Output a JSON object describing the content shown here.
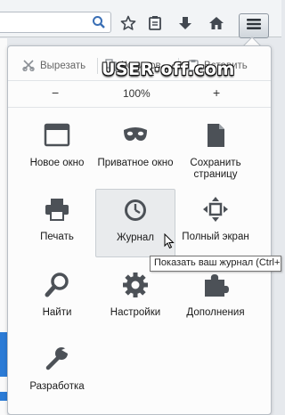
{
  "toolbar": {
    "icons": [
      "search-icon",
      "star-icon",
      "reading-list-icon",
      "download-icon",
      "home-icon",
      "menu-icon"
    ]
  },
  "edit": {
    "cut_label": "Вырезать",
    "copy_label": "Копиров...",
    "paste_label": "Вставить"
  },
  "zoom": {
    "minus": "−",
    "level": "100%",
    "plus": "+"
  },
  "watermark": {
    "text": "USER·off.com"
  },
  "menu_items": [
    {
      "label": "Новое окно",
      "icon": "new-window-icon"
    },
    {
      "label": "Приватное окно",
      "icon": "private-mask-icon"
    },
    {
      "label": "Сохранить страницу",
      "icon": "save-page-icon"
    },
    {
      "label": "Печать",
      "icon": "printer-icon"
    },
    {
      "label": "Журнал",
      "icon": "history-clock-icon"
    },
    {
      "label": "Полный экран",
      "icon": "fullscreen-icon"
    },
    {
      "label": "Найти",
      "icon": "find-magnifier-icon"
    },
    {
      "label": "Настройки",
      "icon": "settings-gear-icon"
    },
    {
      "label": "Дополнения",
      "icon": "addons-puzzle-icon"
    },
    {
      "label": "Разработка",
      "icon": "developer-wrench-icon"
    }
  ],
  "tooltip": {
    "text": "Показать ваш журнал (Ctrl+H)"
  },
  "colors": {
    "icon": "#4c5157",
    "panel_bg": "#fcfcfc",
    "hover_bg": "#e9ebed"
  }
}
